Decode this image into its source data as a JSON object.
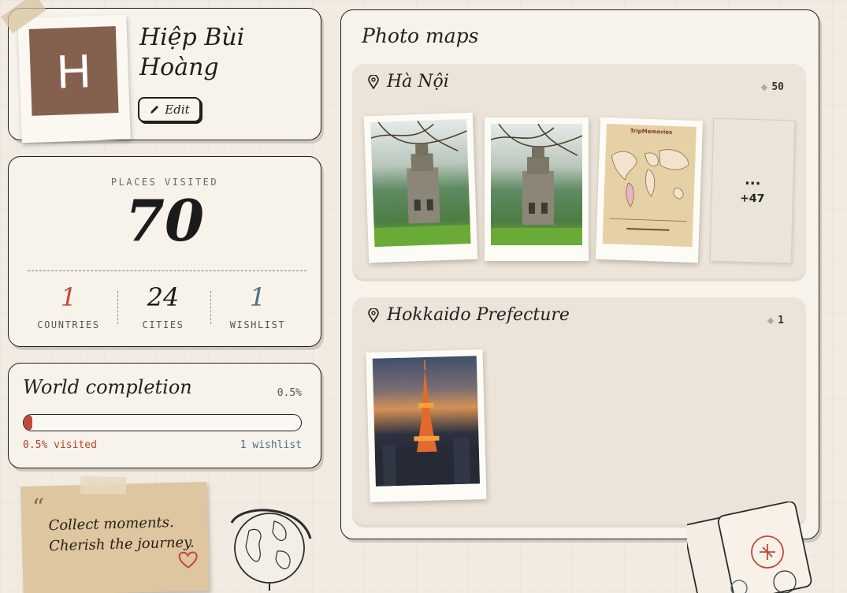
{
  "profile": {
    "avatar_letter": "H",
    "name_line1": "Hiệp Bùi",
    "name_line2": "Hoàng",
    "edit_label": "Edit"
  },
  "stats": {
    "places_label": "PLACES VISITED",
    "places_value": "70",
    "countries": {
      "value": "1",
      "label": "COUNTRIES",
      "color": "#c0493c"
    },
    "cities": {
      "value": "24",
      "label": "CITIES",
      "color": "#1b1b1b"
    },
    "wishlist": {
      "value": "1",
      "label": "WISHLIST",
      "color": "#4c6f8a"
    }
  },
  "completion": {
    "title": "World completion",
    "percent": "0.5%",
    "progress_fraction": 0.005,
    "visited_text": "0.5% visited",
    "wishlist_text": "1 wishlist"
  },
  "note": {
    "line1": "Collect moments.",
    "line2": "Cherish the journey."
  },
  "photo_maps": {
    "title": "Photo maps",
    "groups": [
      {
        "name": "Hà Nội",
        "count": "50",
        "more": "+47",
        "more_dots": "..."
      },
      {
        "name": "Hokkaido Prefecture",
        "count": "1"
      }
    ],
    "map_thumb_brand": "TripMemories"
  },
  "icons": [
    "pencil-icon",
    "map-pin-icon",
    "heart-icon",
    "globe-icon",
    "passport-icon",
    "quote-icon"
  ]
}
